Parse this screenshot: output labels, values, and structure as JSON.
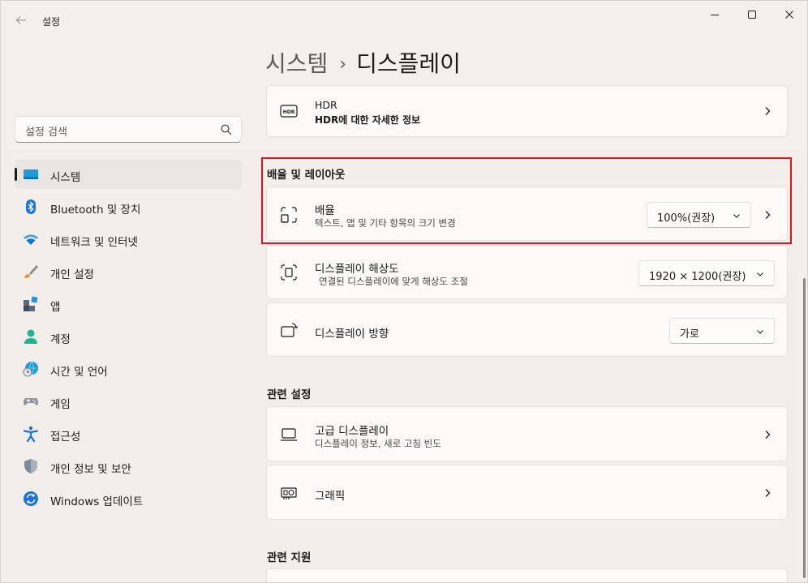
{
  "window": {
    "title": "설정"
  },
  "sidebar": {
    "search_placeholder": "설정 검색",
    "items": [
      {
        "label": "시스템",
        "icon": "system-icon",
        "selected": true
      },
      {
        "label": "Bluetooth 및 장치",
        "icon": "bluetooth-icon"
      },
      {
        "label": "네트워크 및 인터넷",
        "icon": "wifi-icon"
      },
      {
        "label": "개인 설정",
        "icon": "brush-icon"
      },
      {
        "label": "앱",
        "icon": "apps-icon"
      },
      {
        "label": "계정",
        "icon": "person-icon"
      },
      {
        "label": "시간 및 언어",
        "icon": "globe-clock-icon"
      },
      {
        "label": "게임",
        "icon": "gamepad-icon"
      },
      {
        "label": "접근성",
        "icon": "accessibility-icon"
      },
      {
        "label": "개인 정보 및 보안",
        "icon": "shield-icon"
      },
      {
        "label": "Windows 업데이트",
        "icon": "update-icon"
      }
    ]
  },
  "breadcrumb": {
    "root": "시스템",
    "separator": "›",
    "current": "디스플레이"
  },
  "main": {
    "hdr": {
      "title": "HDR",
      "subtitle": "HDR에 대한 자세한 정보",
      "icon": "hdr-icon"
    },
    "scale_layout_section": "배율 및 레이아웃",
    "scale": {
      "title": "배율",
      "subtitle": "텍스트, 앱 및 기타 항목의 크기 변경",
      "value": "100%(권장)",
      "icon": "scale-icon"
    },
    "resolution": {
      "title": "디스플레이 해상도",
      "subtitle": "연결된 디스플레이에 맞게 해상도 조절",
      "value": "1920 × 1200(권장)",
      "icon": "resolution-icon"
    },
    "orientation": {
      "title": "디스플레이 방향",
      "value": "가로",
      "icon": "orientation-icon"
    },
    "related_settings_section": "관련 설정",
    "advanced_display": {
      "title": "고급 디스플레이",
      "subtitle": "디스플레이 정보, 새로 고침 빈도",
      "icon": "monitor-icon"
    },
    "graphics": {
      "title": "그래픽",
      "icon": "graphics-card-icon"
    },
    "related_support_section": "관련 지원"
  },
  "colors": {
    "accent": "#0067c0",
    "highlight_border": "#e0141f"
  }
}
